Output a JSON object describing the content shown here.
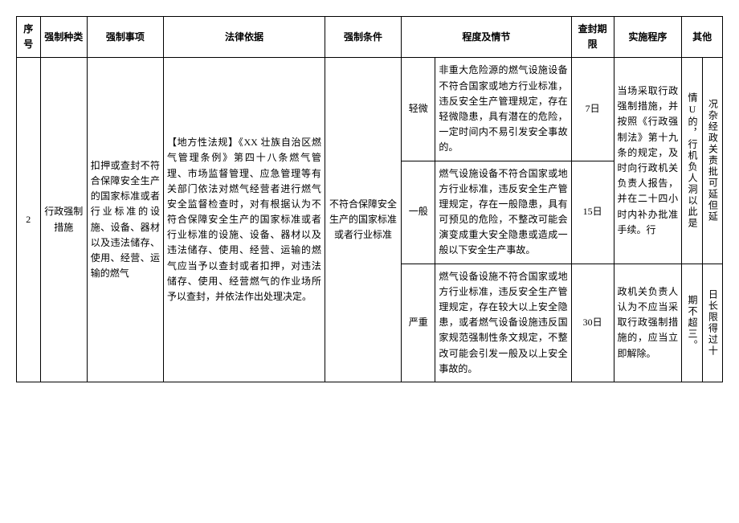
{
  "headers": {
    "seq": "序号",
    "type": "强制种类",
    "matter": "强制事项",
    "basis": "法律依据",
    "condition": "强制条件",
    "level_detail": "程度及情节",
    "period": "查封期限",
    "procedure": "实施程序",
    "other": "其他"
  },
  "row": {
    "seq": "2",
    "type": "行政强制措施",
    "matter": "扣押或查封不符合保障安全生产的国家标准或者行业标准的设施、设备、器材以及违法储存、使用、经营、运输的燃气",
    "basis": "【地方性法规】《XX 壮族自治区燃气管理条例》第四十八条燃气管理、市场监督管理、应急管理等有关部门依法对燃气经营者进行燃气安全监督检查时，对有根据认为不符合保障安全生产的国家标准或者行业标准的设施、设备、器材以及违法储存、使用、经营、运输的燃气应当予以查封或者扣押，对违法储存、使用、经营燃气的作业场所予以查封，并依法作出处理决定。",
    "condition": "不符合保障安全生产的国家标准或者行业标准",
    "levels": [
      {
        "name": "轻微",
        "detail": "非重大危险源的燃气设施设备不符合国家或地方行业标准，违反安全生产管理规定，存在轻微隐患，具有潜在的危险，一定时间内不易引发安全事故的。",
        "period": "7日"
      },
      {
        "name": "一般",
        "detail": "燃气设施设备不符合国家或地方行业标准，违反安全生产管理规定，存在一般隐患，具有可预见的危险，不整改可能会演变成重大安全隐患或造成一般以下安全生产事故。",
        "period": "15日"
      },
      {
        "name": "严重",
        "detail": "燃气设备设施不符合国家或地方行业标准，违反安全生产管理规定，存在较大以上安全隐患，或者燃气设备设施违反国家规范强制性条文规定，不整改可能会引发一般及以上安全事故的。",
        "period": "30日"
      }
    ],
    "procedure_top": "当场采取行政强制措施，并按照《行政强制法》第十九条的规定，及时向行政机关负责人报告，并在二十四小时内补办批准手续。行",
    "procedure_bottom": "政机关负责人认为不应当采取行政强制措施的，应当立即解除。",
    "other_col1": "情U的，行机负人洞以此是",
    "other_col2": "况杂经政关责批可延但延",
    "other_bottom1": "期不超三。",
    "other_bottom2": "日长限得过十"
  }
}
